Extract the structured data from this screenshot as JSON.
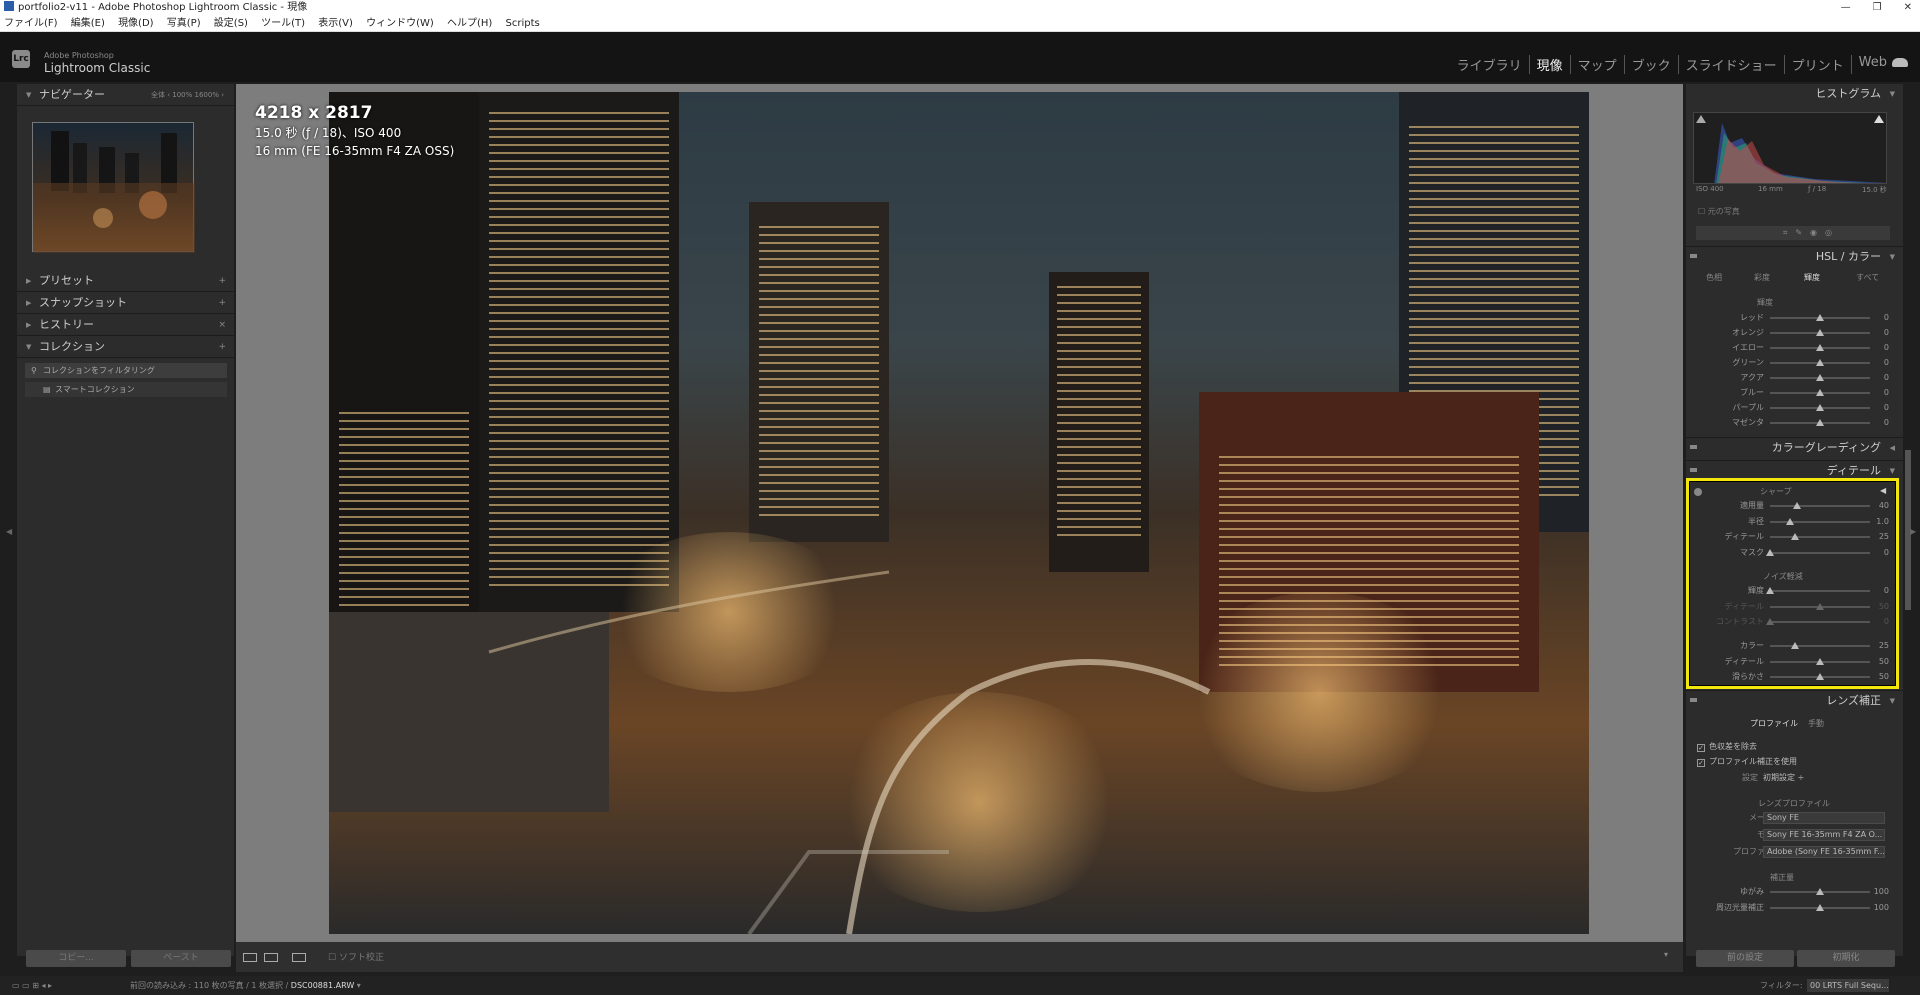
{
  "window": {
    "title": "portfolio2-v11 - Adobe Photoshop Lightroom Classic - 現像",
    "controls": [
      "—",
      "❐",
      "✕"
    ]
  },
  "menu": [
    "ファイル(F)",
    "編集(E)",
    "現像(D)",
    "写真(P)",
    "設定(S)",
    "ツール(T)",
    "表示(V)",
    "ウィンドウ(W)",
    "ヘルプ(H)",
    "Scripts"
  ],
  "brand": {
    "badge": "Lrc",
    "sub": "Adobe Photoshop",
    "main": "Lightroom Classic"
  },
  "modules": [
    "ライブラリ",
    "現像",
    "マップ",
    "ブック",
    "スライドショー",
    "プリント",
    "Web"
  ],
  "left": {
    "navigator": {
      "title": "ナビゲーター",
      "zoom": "全体  ‹  100%  1600%  ›"
    },
    "presets": "プリセット",
    "snapshots": "スナップショット",
    "history": "ヒストリー",
    "collections": "コレクション",
    "collection_items": [
      "コレクションをフィルタリング",
      "スマートコレクション"
    ],
    "copy": "コピー...",
    "paste": "ペースト"
  },
  "photo_info": {
    "size": "4218 x 2817",
    "exposure": "15.0 秒 (ƒ / 18)、ISO 400",
    "lens": "16 mm (FE 16-35mm F4 ZA OSS)"
  },
  "toolbar": {
    "softproof": "ソフト校正"
  },
  "right": {
    "histogram": {
      "title": "ヒストグラム",
      "iso": "ISO 400",
      "focal": "16 mm",
      "aperture": "ƒ / 18",
      "shutter": "15.0 秒",
      "original": "元の写真"
    },
    "hsl": {
      "title": "HSL / カラー",
      "tabs": [
        "色相",
        "彩度",
        "輝度",
        "すべて"
      ],
      "sub": "輝度",
      "rows": [
        {
          "label": "レッド",
          "value": "0",
          "pos": 0.5
        },
        {
          "label": "オレンジ",
          "value": "0",
          "pos": 0.5
        },
        {
          "label": "イエロー",
          "value": "0",
          "pos": 0.5
        },
        {
          "label": "グリーン",
          "value": "0",
          "pos": 0.5
        },
        {
          "label": "アクア",
          "value": "0",
          "pos": 0.5
        },
        {
          "label": "ブルー",
          "value": "0",
          "pos": 0.5
        },
        {
          "label": "パープル",
          "value": "0",
          "pos": 0.5
        },
        {
          "label": "マゼンタ",
          "value": "0",
          "pos": 0.5
        }
      ]
    },
    "color_grading": "カラーグレーディング",
    "detail": {
      "title": "ディテール",
      "sharpen_title": "シャープ",
      "sharpen": [
        {
          "label": "適用量",
          "value": "40",
          "pos": 0.27
        },
        {
          "label": "半径",
          "value": "1.0",
          "pos": 0.2
        },
        {
          "label": "ディテール",
          "value": "25",
          "pos": 0.25
        },
        {
          "label": "マスク",
          "value": "0",
          "pos": 0.0
        }
      ],
      "noise_title": "ノイズ軽減",
      "noise": [
        {
          "label": "輝度",
          "value": "0",
          "pos": 0.0,
          "dim": false
        },
        {
          "label": "ディテール",
          "value": "50",
          "pos": 0.5,
          "dim": true
        },
        {
          "label": "コントラスト",
          "value": "0",
          "pos": 0.0,
          "dim": true
        },
        {
          "label": "カラー",
          "value": "25",
          "pos": 0.25,
          "dim": false
        },
        {
          "label": "ディテール",
          "value": "50",
          "pos": 0.5,
          "dim": false
        },
        {
          "label": "滑らかさ",
          "value": "50",
          "pos": 0.5,
          "dim": false
        }
      ]
    },
    "lens": {
      "title": "レンズ補正",
      "tabs": [
        "プロファイル",
        "手動"
      ],
      "check1": "色収差を除去",
      "check2": "プロファイル補正を使用",
      "setting_label": "設定",
      "setting_value": "初期設定 ÷",
      "profile_head": "レンズプロファイル",
      "maker_label": "メーカー",
      "maker": "Sony FE",
      "model_label": "モデル",
      "model": "Sony FE 16-35mm F4 ZA O...",
      "profile_label": "プロファイル",
      "profile": "Adobe (Sony FE 16-35mm F...",
      "amount_head": "補正量",
      "amount": [
        {
          "label": "ゆがみ",
          "value": "100",
          "pos": 0.5
        },
        {
          "label": "周辺光量補正",
          "value": "100",
          "pos": 0.5
        }
      ]
    },
    "prev": "前の設定",
    "reset": "初期化"
  },
  "filmstrip": {
    "prefix": "前回の読み込み",
    "count": "110 枚の写真 / 1 枚選択 /",
    "filename": "DSC00881.ARW",
    "filter_label": "フィルター:",
    "preset": "00 LRTS Full Sequ..."
  },
  "colors": {
    "highlight": "#f2e60d",
    "panel": "#2c2c2c",
    "center": "#7d7d7d"
  }
}
